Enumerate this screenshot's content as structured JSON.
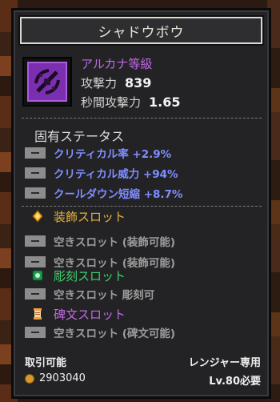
{
  "item": {
    "name": "シャドウボウ",
    "grade": "アルカナ等級",
    "attack_label": "攻撃力",
    "attack_value": "839",
    "dps_label": "秒間攻撃力",
    "dps_value": "1.65",
    "icon": "shadow-bow-icon"
  },
  "unique_stats": {
    "title": "固有ステータス",
    "items": [
      {
        "label": "クリティカル率 +2.9%"
      },
      {
        "label": "クリティカル威力 +94%"
      },
      {
        "label": "クールダウン短縮 +8.7%"
      }
    ]
  },
  "slots": {
    "accessory": {
      "title": "装飾スロット",
      "icon": "diamond-gem-icon",
      "items": [
        "空きスロット (装飾可能)",
        "空きスロット (装飾可能)"
      ]
    },
    "engrave": {
      "title": "彫刻スロット",
      "icon": "green-gem-icon",
      "items": [
        "空きスロット 彫刻可"
      ]
    },
    "rune": {
      "title": "碑文スロット",
      "icon": "scroll-icon",
      "items": [
        "空きスロット (碑文可能)"
      ]
    }
  },
  "footer": {
    "tradable": "取引可能",
    "class_restriction": "レンジャー専用",
    "price": "2903040",
    "level_req": "Lv.80必要"
  },
  "colors": {
    "grade": "#c468e6",
    "stat_blue": "#7f8eff",
    "accessory_gold": "#e8b23a",
    "engrave_green": "#3fcf6a",
    "rune_purple": "#c468e6"
  }
}
